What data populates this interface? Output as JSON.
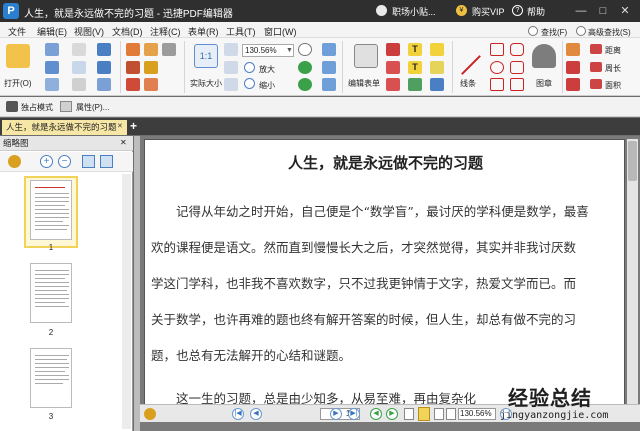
{
  "titlebar": {
    "logo": "P",
    "title": "人生，就是永远做不完的习题 - 迅捷PDF编辑器",
    "user": "职场小贴...",
    "vip": "购买VIP",
    "help": "帮助",
    "minimize": "—",
    "maximize": "□",
    "close": "✕"
  },
  "menu": [
    "文件",
    "编辑(E)",
    "视图(V)",
    "文档(D)",
    "注释(C)",
    "表单(R)",
    "工具(T)",
    "窗口(W)"
  ],
  "ribbon": {
    "open_label": "打开(O)",
    "actual_size": "实际大小",
    "zoom_value": "130.56%",
    "zoom_in": "放大",
    "zoom_out": "缩小",
    "edit_form": "编辑表单",
    "lines": "线条",
    "stamp": "图章",
    "find": "查找(F)",
    "advanced_find": "高级查找(S)",
    "distance": "距离",
    "perimeter": "周长",
    "area": "面积"
  },
  "toolbar2": {
    "exclusive_mode": "独占模式",
    "properties": "属性(P)..."
  },
  "tab": {
    "label": "人生，就是永远做不完的习题",
    "close": "✕",
    "add": "+"
  },
  "thumbnails": {
    "header": "缩略图",
    "pages": [
      "1",
      "2",
      "3"
    ]
  },
  "document": {
    "title": "人生，就是永远做不完的习题",
    "lines": [
      "　　记得从年幼之时开始，自己便是个“数学盲”，最讨厌的学科便是数学，最喜",
      "欢的课程便是语文。然而直到慢慢长大之后，才突然觉得，其实并非我讨厌数",
      "学这门学科，也非我不喜欢数字，只不过我更钟情于文字，热爱文学而已。而",
      "关于数学，也许再难的题也终有解开答案的时候，但人生，却总有做不完的习",
      "题，也总有无法解开的心结和谜题。",
      "　　这一生的习题，总是由少知多，从易至难，再由复杂化"
    ]
  },
  "statusbar": {
    "page_value": "1",
    "page_total": "/3",
    "zoom_value": "130.56%"
  },
  "watermark": {
    "text": "经验总结",
    "url": "jingyanzongjie.com"
  },
  "colors": {
    "accent_blue": "#2a7fd0",
    "tab_yellow": "#f6e7a6",
    "titlebar": "#2f2f2f"
  }
}
